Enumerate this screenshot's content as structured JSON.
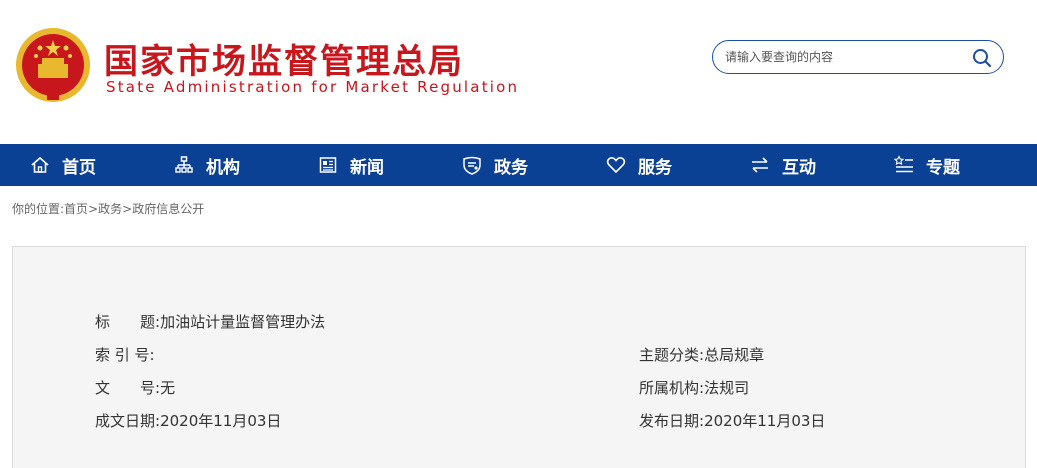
{
  "header": {
    "title_cn": "国家市场监督管理总局",
    "title_en": "State Administration for Market Regulation",
    "search_placeholder": "请输入要查询的内容",
    "emblem_icon": "national-emblem-icon",
    "search_icon": "search-icon"
  },
  "nav": {
    "items": [
      {
        "label": "首页",
        "icon": "home-icon"
      },
      {
        "label": "机构",
        "icon": "org-chart-icon"
      },
      {
        "label": "新闻",
        "icon": "news-icon"
      },
      {
        "label": "政务",
        "icon": "shield-icon"
      },
      {
        "label": "服务",
        "icon": "heart-icon"
      },
      {
        "label": "互动",
        "icon": "exchange-arrows-icon"
      },
      {
        "label": "专题",
        "icon": "topic-list-icon"
      }
    ]
  },
  "breadcrumb": {
    "prefix": "你的位置:",
    "items": [
      "首页",
      "政务",
      "政府信息公开"
    ],
    "separator": ">"
  },
  "info": {
    "title_label": "标　　题:",
    "title_value": "加油站计量监督管理办法",
    "index_label": "索 引 号:",
    "index_value": "",
    "doc_no_label": "文　　号:",
    "doc_no_value": "无",
    "date_label": "成文日期:",
    "date_value": "2020年11月03日",
    "category_label": "主题分类:",
    "category_value": "总局规章",
    "org_label": "所属机构:",
    "org_value": "法规司",
    "publish_label": "发布日期:",
    "publish_value": "2020年11月03日"
  },
  "colors": {
    "brand_red": "#c8161d",
    "nav_blue": "#0b4194",
    "search_border": "#1c4fa0"
  }
}
